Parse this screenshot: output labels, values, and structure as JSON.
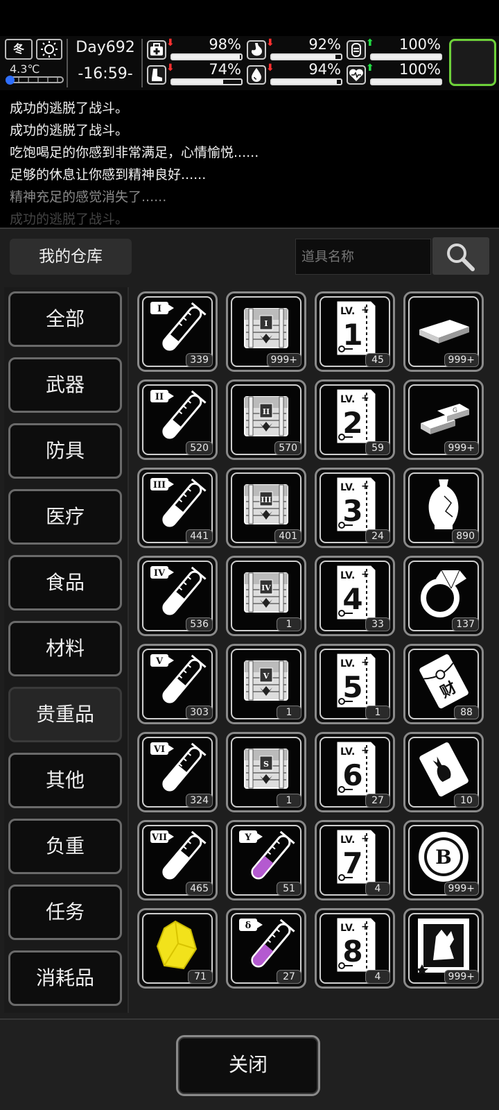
{
  "status": {
    "season": "冬",
    "weather_icon": "sun-icon",
    "temperature": "4.3℃",
    "day": "Day692",
    "time": "-16:59-",
    "stats": [
      {
        "icon": "medkit-icon",
        "trend": "down",
        "value": "98%",
        "level": 0.98
      },
      {
        "icon": "stomach-icon",
        "trend": "down",
        "value": "92%",
        "level": 0.92
      },
      {
        "icon": "energy-icon",
        "trend": "up",
        "value": "100%",
        "level": 1.0
      },
      {
        "icon": "boot-icon",
        "trend": "down",
        "value": "74%",
        "level": 0.74
      },
      {
        "icon": "water-drop-icon",
        "trend": "down",
        "value": "94%",
        "level": 0.94
      },
      {
        "icon": "heart-icon",
        "trend": "up",
        "value": "100%",
        "level": 1.0
      }
    ],
    "colors": {
      "down": "#ff3030",
      "up": "#22dd44",
      "slot_border": "#6ed13a",
      "temp_dot": "#2f6fff"
    }
  },
  "log": [
    "成功的逃脱了战斗。",
    "成功的逃脱了战斗。",
    "吃饱喝足的你感到非常满足，心情愉悦......",
    "足够的休息让你感到精神良好......",
    "精神充足的感觉消失了......",
    "成功的逃脱了战斗。"
  ],
  "warehouse": {
    "title": "我的仓库",
    "search_placeholder": "道具名称",
    "close_label": "关闭",
    "categories": [
      {
        "label": "全部",
        "active": false
      },
      {
        "label": "武器",
        "active": false
      },
      {
        "label": "防具",
        "active": false
      },
      {
        "label": "医疗",
        "active": false
      },
      {
        "label": "食品",
        "active": false
      },
      {
        "label": "材料",
        "active": false
      },
      {
        "label": "贵重品",
        "active": true
      },
      {
        "label": "其他",
        "active": false
      },
      {
        "label": "负重",
        "active": false
      },
      {
        "label": "任务",
        "active": false
      },
      {
        "label": "消耗品",
        "active": false
      }
    ],
    "items": [
      {
        "icon": "test-tube-icon",
        "tag": "I",
        "count": "339",
        "fill": 0.3,
        "liquid": "#ffffff"
      },
      {
        "icon": "treasure-chest-icon",
        "tag": "I",
        "count": "999+"
      },
      {
        "icon": "skill-book-icon",
        "tag": "1",
        "count": "45"
      },
      {
        "icon": "cash-stack-icon",
        "count": "999+"
      },
      {
        "icon": "test-tube-icon",
        "tag": "II",
        "count": "520",
        "fill": 0.4,
        "liquid": "#ffffff"
      },
      {
        "icon": "treasure-chest-icon",
        "tag": "II",
        "count": "570"
      },
      {
        "icon": "skill-book-icon",
        "tag": "2",
        "count": "59"
      },
      {
        "icon": "gold-bars-icon",
        "count": "999+"
      },
      {
        "icon": "test-tube-icon",
        "tag": "III",
        "count": "441",
        "fill": 0.5,
        "liquid": "#ffffff"
      },
      {
        "icon": "treasure-chest-icon",
        "tag": "III",
        "count": "401"
      },
      {
        "icon": "skill-book-icon",
        "tag": "3",
        "count": "24"
      },
      {
        "icon": "vase-icon",
        "count": "890"
      },
      {
        "icon": "test-tube-icon",
        "tag": "IV",
        "count": "536",
        "fill": 0.55,
        "liquid": "#ffffff"
      },
      {
        "icon": "treasure-chest-icon",
        "tag": "IV",
        "count": "1"
      },
      {
        "icon": "skill-book-icon",
        "tag": "4",
        "count": "33"
      },
      {
        "icon": "diamond-ring-icon",
        "count": "137"
      },
      {
        "icon": "test-tube-icon",
        "tag": "V",
        "count": "303",
        "fill": 0.6,
        "liquid": "#ffffff"
      },
      {
        "icon": "treasure-chest-icon",
        "tag": "V",
        "count": "1"
      },
      {
        "icon": "skill-book-icon",
        "tag": "5",
        "count": "1"
      },
      {
        "icon": "red-envelope-icon",
        "count": "88"
      },
      {
        "icon": "test-tube-icon",
        "tag": "VI",
        "count": "324",
        "fill": 0.65,
        "liquid": "#ffffff"
      },
      {
        "icon": "treasure-chest-icon",
        "tag": "S",
        "count": "1"
      },
      {
        "icon": "skill-book-icon",
        "tag": "6",
        "count": "27"
      },
      {
        "icon": "rabbit-packet-icon",
        "count": "10"
      },
      {
        "icon": "test-tube-icon",
        "tag": "VII",
        "count": "465",
        "fill": 0.75,
        "liquid": "#ffffff"
      },
      {
        "icon": "test-tube-icon",
        "tag": "Y",
        "count": "51",
        "fill": 0.55,
        "liquid": "#b45ad0"
      },
      {
        "icon": "skill-book-icon",
        "tag": "7",
        "count": "4"
      },
      {
        "icon": "bitcoin-chip-icon",
        "count": "999+"
      },
      {
        "icon": "yellow-crystal-icon",
        "count": "71"
      },
      {
        "icon": "test-tube-icon",
        "tag": "δ",
        "count": "27",
        "fill": 0.55,
        "liquid": "#b45ad0"
      },
      {
        "icon": "skill-book-icon",
        "tag": "8",
        "count": "4"
      },
      {
        "icon": "monster-card-icon",
        "count": "999+"
      }
    ]
  }
}
